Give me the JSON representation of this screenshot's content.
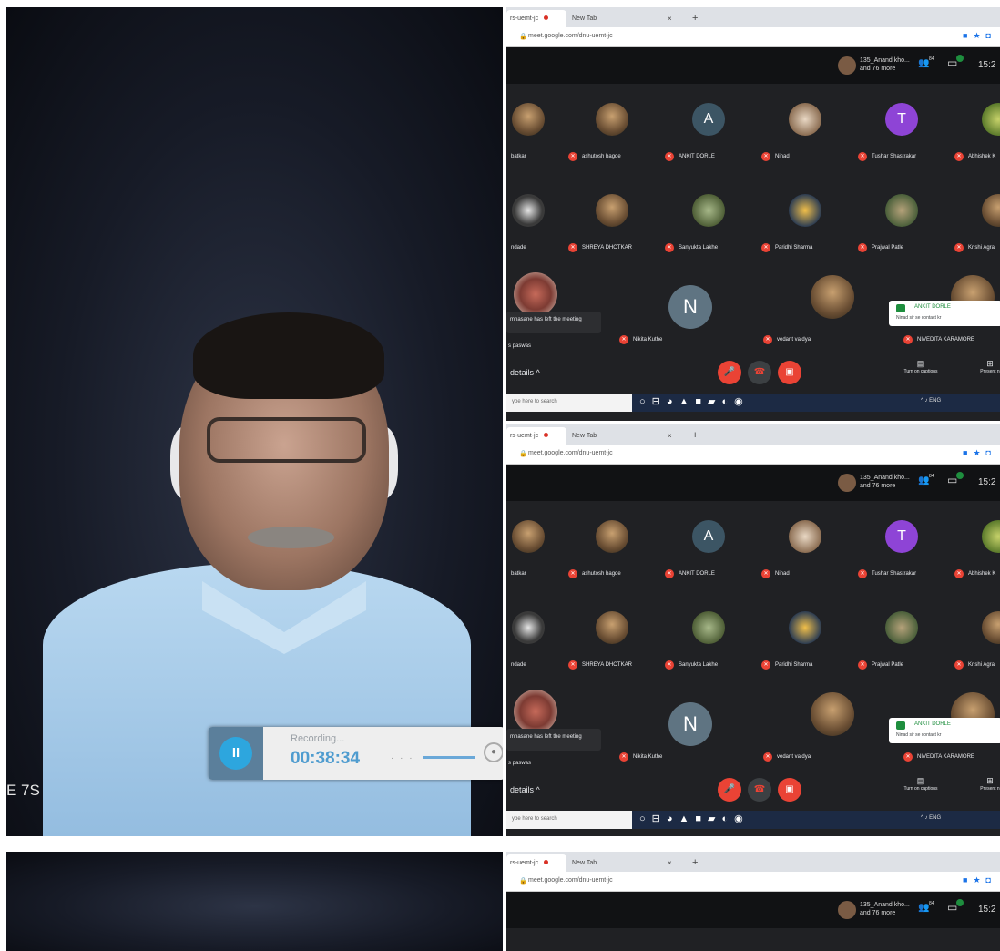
{
  "photo": {
    "side_text": "E 7S",
    "recorder": {
      "status": "Recording...",
      "time": "00:38:34",
      "pause_glyph": "II"
    }
  },
  "browser": {
    "tab1_title": "rs-uemt-jc",
    "tab2_title": "New Tab",
    "tab_close": "×",
    "new_tab": "+",
    "url": "meet.google.com/dnu-uemt-jc"
  },
  "meet": {
    "presenter": "135_Anand kho...",
    "presenter_sub": "and 76 more",
    "clock": "15:2",
    "participants_count": "84",
    "row1": [
      "batkar",
      "ashutosh bagde",
      "ANKIT DORLE",
      "Ninad",
      "Tushar Shastrakar",
      "Abhishek K"
    ],
    "row2": [
      "ndade",
      "SHREYA DHOTKAR",
      "Sanyukta Lakhe",
      "Paridhi Sharma",
      "Prajwal Patle",
      "Krishi Agra"
    ],
    "row3": [
      "s paswas",
      "Nikita Kuthe",
      "vedant vaidya",
      "NIVEDITA KARAMORE"
    ],
    "row1_initials": {
      "ankit": "A",
      "tushar": "T"
    },
    "row3_initial": "N",
    "left_message": "mnasane has left the meeting",
    "notification": {
      "title": "ANKIT DORLE",
      "body": "Ninad sir se contact kr"
    },
    "details_label": "details ^",
    "captions_label": "Turn on captions",
    "present_label": "Present n"
  },
  "taskbar": {
    "search_placeholder": "ype here to search",
    "tray": "^ ♪ ENG"
  },
  "colors": {
    "mute_red": "#ea4335",
    "meet_dark": "#202124",
    "accent_green": "#1e8e3e",
    "recording_blue": "#4f9ccf"
  }
}
